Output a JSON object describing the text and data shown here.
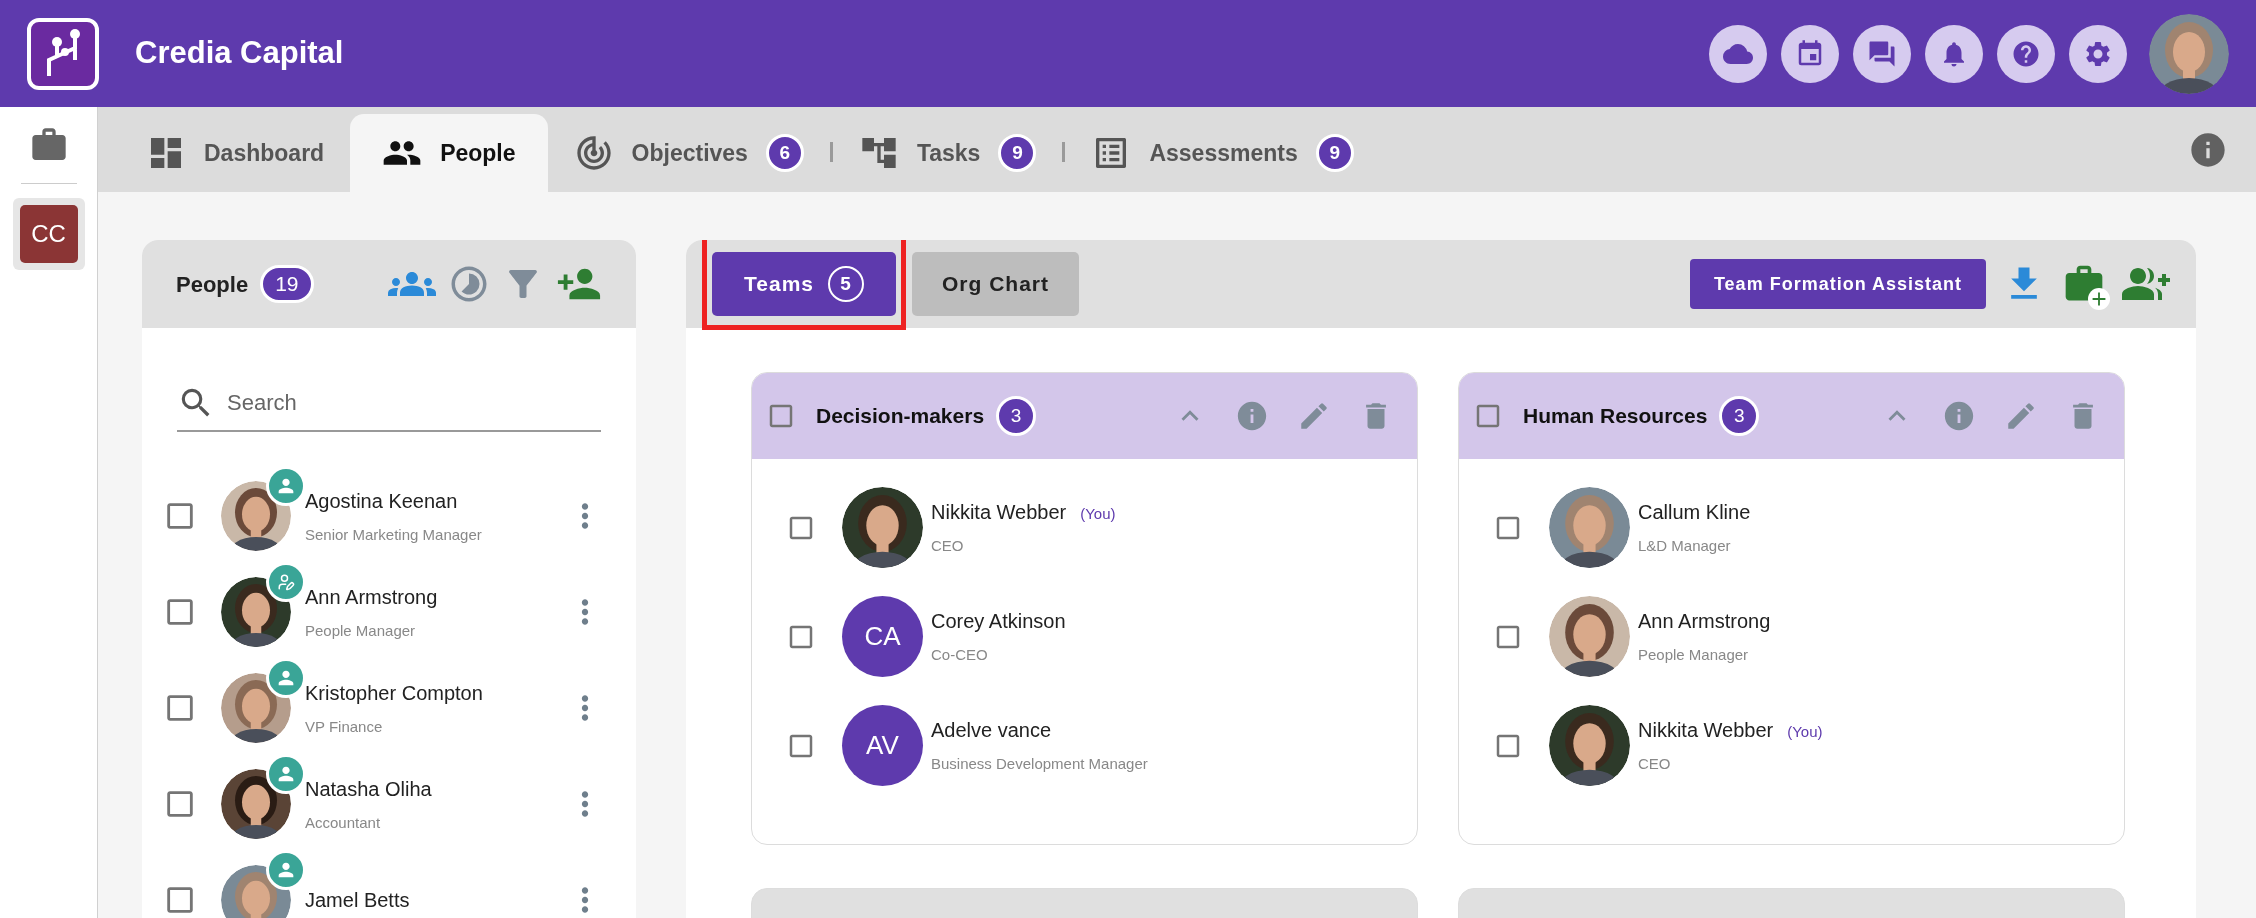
{
  "header": {
    "title": "Credia Capital"
  },
  "sidebar": {
    "workspaces": [
      {
        "initials": "CC",
        "selected": true
      }
    ]
  },
  "tabs": [
    {
      "label": "Dashboard",
      "kind": "dashboard",
      "selected": false
    },
    {
      "label": "People",
      "kind": "people",
      "selected": true
    },
    {
      "label": "Objectives",
      "kind": "target",
      "count": "6",
      "selected": false
    },
    {
      "label": "Tasks",
      "kind": "tree",
      "count": "9",
      "selected": false
    },
    {
      "label": "Assessments",
      "kind": "list",
      "count": "9",
      "selected": false
    }
  ],
  "people_panel": {
    "title": "People",
    "count": "19",
    "search": {
      "placeholder": "Search"
    },
    "people": [
      {
        "name": "Agostina Keenan",
        "role": "Senior Marketing Manager",
        "kind": "member",
        "checked": false
      },
      {
        "name": "Ann Armstrong",
        "role": "People Manager",
        "kind": "editor",
        "checked": false
      },
      {
        "name": "Kristopher Compton",
        "role": "VP Finance",
        "kind": "member",
        "checked": false
      },
      {
        "name": "Natasha Oliha",
        "role": "Accountant",
        "kind": "member",
        "checked": false
      },
      {
        "name": "Jamel Betts",
        "kind": "member",
        "checked": false
      }
    ]
  },
  "view_tabs": [
    {
      "label": "Teams",
      "count": "5",
      "selected": true
    },
    {
      "label": "Org Chart",
      "selected": false
    }
  ],
  "assistant_button": "Team Formation Assistant",
  "teams": [
    {
      "kind": "team",
      "name": "Decision-makers",
      "count": "3",
      "checked": false,
      "expanded": true,
      "members": [
        {
          "name": "Nikkita Webber",
          "you": "(You)",
          "role": "CEO",
          "checked": false
        },
        {
          "name": "Corey Atkinson",
          "role": "Co-CEO",
          "avatar": {
            "kind": "initials",
            "initials": "CA"
          },
          "checked": false
        },
        {
          "name": "Adelve vance",
          "role": "Business Development Manager",
          "avatar": {
            "kind": "initials",
            "initials": "AV"
          },
          "checked": false
        }
      ]
    },
    {
      "kind": "team",
      "name": "Human Resources",
      "count": "3",
      "checked": false,
      "expanded": true,
      "members": [
        {
          "name": "Callum Kline",
          "role": "L&D Manager",
          "checked": false
        },
        {
          "name": "Ann Armstrong",
          "role": "People Manager",
          "checked": false
        },
        {
          "name": "Nikkita Webber",
          "you": "(You)",
          "role": "CEO",
          "checked": false
        }
      ]
    },
    {
      "kind": "preview"
    },
    {
      "kind": "preview"
    }
  ]
}
